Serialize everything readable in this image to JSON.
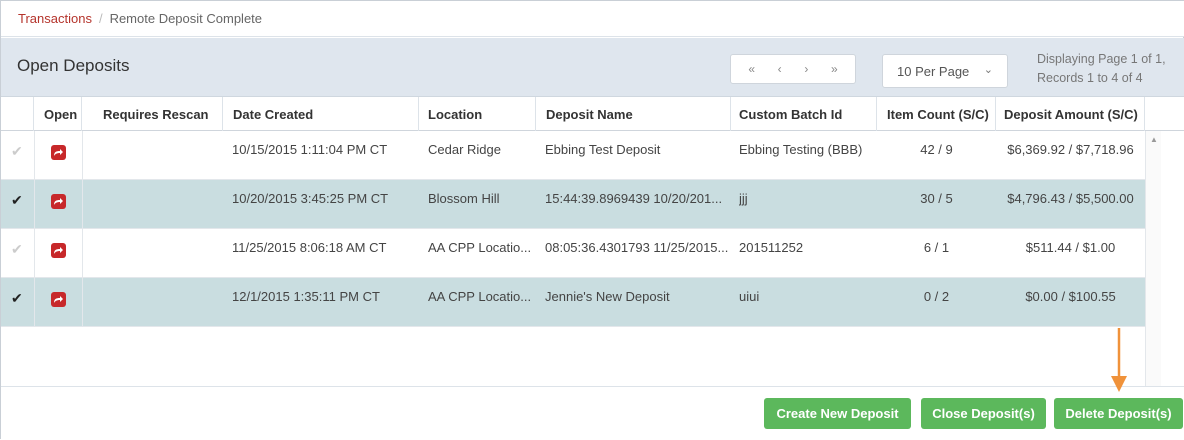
{
  "breadcrumb": {
    "link": "Transactions",
    "separator": "/",
    "current": "Remote Deposit Complete"
  },
  "header": {
    "title": "Open Deposits",
    "pager": {
      "first": "«",
      "prev": "‹",
      "next": "›",
      "last": "»"
    },
    "per_page": {
      "selected": "10 Per Page",
      "icon": "chevron-down-icon"
    },
    "displaying_line1": "Displaying Page 1 of 1,",
    "displaying_line2": "Records 1 to 4 of 4"
  },
  "table": {
    "columns": [
      "Open",
      "Requires Rescan",
      "Date Created",
      "Location",
      "Deposit Name",
      "Custom Batch Id",
      "Item Count (S/C)",
      "Deposit Amount (S/C)"
    ],
    "rows": [
      {
        "selected": "false",
        "date": "10/15/2015 1:11:04 PM CT",
        "location": "Cedar Ridge",
        "name": "Ebbing Test Deposit",
        "batch": "Ebbing Testing (BBB)",
        "count": "42 / 9",
        "amount": "$6,369.92 / $7,718.96"
      },
      {
        "selected": "true",
        "date": "10/20/2015 3:45:25 PM CT",
        "location": "Blossom Hill",
        "name": "15:44:39.8969439 10/20/201...",
        "batch": "jjj",
        "count": "30 / 5",
        "amount": "$4,796.43 / $5,500.00"
      },
      {
        "selected": "false",
        "date": "11/25/2015 8:06:18 AM CT",
        "location": "AA CPP Locatio...",
        "name": "08:05:36.4301793 11/25/2015...",
        "batch": "201511252",
        "count": "6 / 1",
        "amount": "$511.44 / $1.00"
      },
      {
        "selected": "true",
        "date": "12/1/2015 1:35:11 PM CT",
        "location": "AA CPP Locatio...",
        "name": "Jennie's New Deposit",
        "batch": "uiui",
        "count": "0 / 2",
        "amount": "$0.00 / $100.55"
      }
    ]
  },
  "footer": {
    "create_label": "Create New Deposit",
    "close_label": "Close Deposit(s)",
    "delete_label": "Delete Deposit(s)"
  },
  "colors": {
    "brand_red": "#b5342c",
    "open_icon": "#c7282a",
    "button_green": "#5cb85c",
    "selected_row": "#c9dde0",
    "header_bg": "#dfe6ee",
    "annotation_arrow": "#f0923a"
  }
}
